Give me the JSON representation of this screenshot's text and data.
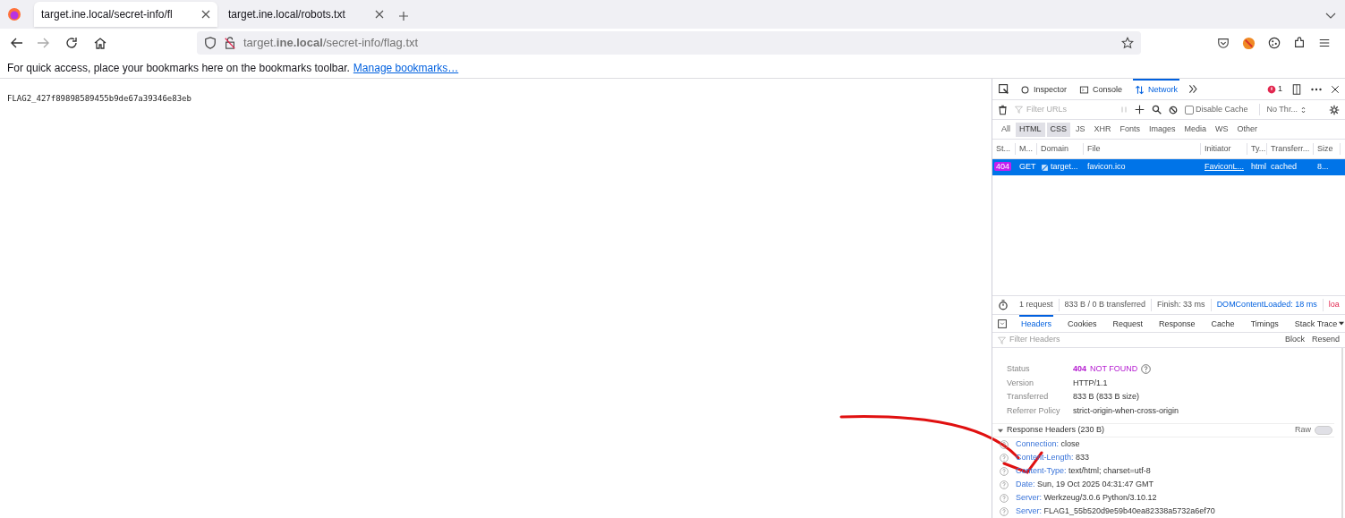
{
  "tabs": [
    {
      "label": "target.ine.local/secret-info/fl",
      "selected": true
    },
    {
      "label": "target.ine.local/robots.txt",
      "selected": false
    }
  ],
  "url": "target.**ine.local**/secret-info/flag.txt",
  "bookmarks_bar": {
    "text": "For quick access, place your bookmarks here on the bookmarks toolbar.",
    "link": "Manage bookmarks…"
  },
  "page_text": "FLAG2_427f89898589455b9de67a39346e83eb",
  "devtools": {
    "tabs": [
      {
        "label": "Inspector",
        "selected": false
      },
      {
        "label": "Console",
        "selected": false
      },
      {
        "label": "Network",
        "selected": true
      }
    ],
    "error_count": "1",
    "filter": {
      "placeholder": "Filter URLs"
    },
    "disable_cache": {
      "label": "Disable Cache",
      "checked": false
    },
    "throttle": "No Thr...",
    "type_filters": [
      {
        "label": "All",
        "selected": false
      },
      {
        "label": "HTML",
        "selected": true
      },
      {
        "label": "CSS",
        "selected": true
      },
      {
        "label": "JS",
        "selected": false
      },
      {
        "label": "XHR",
        "selected": false
      },
      {
        "label": "Fonts",
        "selected": false
      },
      {
        "label": "Images",
        "selected": false
      },
      {
        "label": "Media",
        "selected": false
      },
      {
        "label": "WS",
        "selected": false
      },
      {
        "label": "Other",
        "selected": false
      }
    ],
    "columns": [
      "St...",
      "M...",
      "Domain",
      "File",
      "Initiator",
      "Ty...",
      "Transferr...",
      "Size"
    ],
    "rows": [
      {
        "selected": true,
        "cells": [
          "404",
          "GET",
          "target...",
          "favicon.ico",
          "FaviconL...",
          "html",
          "cached",
          "8..."
        ]
      }
    ],
    "summary": [
      {
        "kind": "plain",
        "text": "1 request"
      },
      {
        "kind": "plain",
        "text": "833 B / 0 B transferred"
      },
      {
        "kind": "plain",
        "text": "Finish: 33 ms"
      },
      {
        "kind": "blue",
        "text": "DOMContentLoaded: 18 ms"
      },
      {
        "kind": "red",
        "text": "loa"
      }
    ],
    "detail_tabs": [
      {
        "label": "Headers",
        "selected": true
      },
      {
        "label": "Cookies",
        "selected": false
      },
      {
        "label": "Request",
        "selected": false
      },
      {
        "label": "Response",
        "selected": false
      },
      {
        "label": "Cache",
        "selected": false
      },
      {
        "label": "Timings",
        "selected": false
      },
      {
        "label": "Stack Trace",
        "selected": false
      }
    ],
    "filter_headers": {
      "placeholder": "Filter Headers"
    },
    "header_buttons": [
      "Block",
      "Resend"
    ],
    "summary_fields": [
      {
        "label": "Status",
        "value": "404",
        "value_note": "NOT FOUND",
        "kind": "status"
      },
      {
        "label": "Version",
        "value": "HTTP/1.1",
        "kind": "plain"
      },
      {
        "label": "Transferred",
        "value": "833 B (833 B size)",
        "kind": "plain"
      },
      {
        "label": "Referrer Policy",
        "value": "strict-origin-when-cross-origin",
        "kind": "plain"
      }
    ],
    "response_headers": {
      "title": "Response Headers (230 B)",
      "expanded": true,
      "raw_label": "Raw",
      "raw_on": false,
      "items": [
        {
          "name": "Connection:",
          "value": "close"
        },
        {
          "name": "Content-Length:",
          "value": "833"
        },
        {
          "name": "Content-Type:",
          "value": "text/html; charset=utf-8"
        },
        {
          "name": "Date:",
          "value": "Sun, 19 Oct 2025 04:31:47 GMT"
        },
        {
          "name": "Server:",
          "value": "Werkzeug/3.0.6 Python/3.10.12"
        },
        {
          "name": "Server:",
          "value": "FLAG1_55b520d9e59b40ea82338a5732a6ef70"
        }
      ]
    }
  }
}
